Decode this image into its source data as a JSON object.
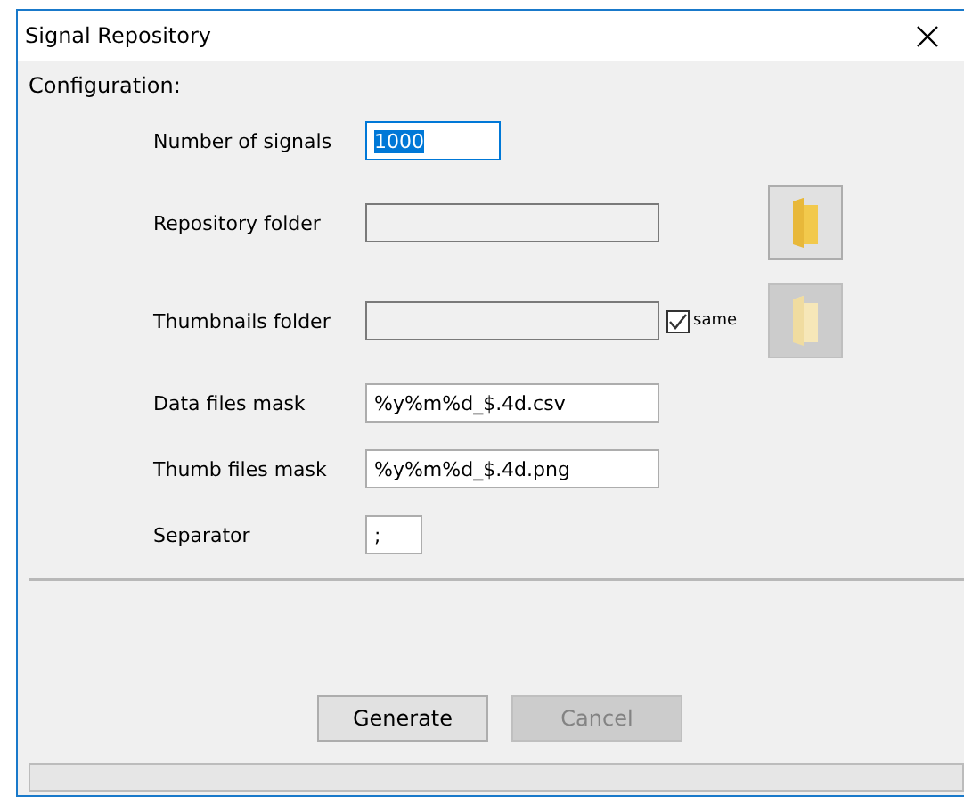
{
  "window": {
    "title": "Signal Repository"
  },
  "section_label": "Configuration:",
  "rows": [
    {
      "kind": "count",
      "label": "Number of signals",
      "value": "1000",
      "focused": true
    },
    {
      "kind": "path",
      "label": "Repository folder",
      "value": "",
      "browse_disabled": false
    },
    {
      "kind": "path",
      "label": "Thumbnails folder",
      "value": "",
      "browse_disabled": true,
      "same": {
        "label": "same",
        "checked": true
      }
    },
    {
      "kind": "mask",
      "label": "Data files mask",
      "value": "%y%m%d_$.4d.csv",
      "focused": false
    },
    {
      "kind": "mask",
      "label": "Thumb files mask",
      "value": "%y%m%d_$.4d.png",
      "focused": false
    },
    {
      "kind": "char",
      "label": "Separator",
      "value": ";",
      "focused": false
    }
  ],
  "buttons": [
    {
      "label": "Generate",
      "disabled": false
    },
    {
      "label": "Cancel",
      "disabled": true
    }
  ],
  "progress": {
    "level": 0
  }
}
